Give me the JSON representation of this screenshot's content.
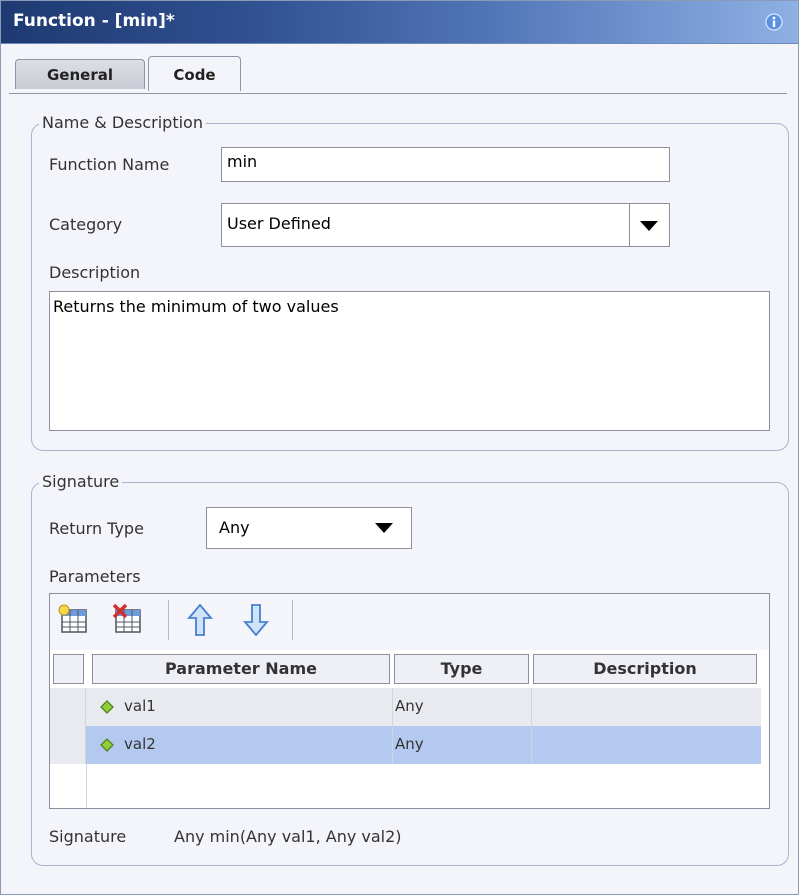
{
  "window": {
    "title": "Function - [min]*"
  },
  "tabs": [
    {
      "label": "General",
      "active": false
    },
    {
      "label": "Code",
      "active": true
    }
  ],
  "name_description": {
    "legend": "Name & Description",
    "function_name_label": "Function Name",
    "function_name_value": "min",
    "category_label": "Category",
    "category_value": "User Defined",
    "description_label": "Description",
    "description_value": "Returns the minimum of two values"
  },
  "signature": {
    "legend": "Signature",
    "return_type_label": "Return Type",
    "return_type_value": "Any",
    "parameters_label": "Parameters",
    "toolbar": [
      "add-parameter-icon",
      "delete-parameter-icon",
      "move-up-icon",
      "move-down-icon"
    ],
    "columns": [
      "Parameter Name",
      "Type",
      "Description"
    ],
    "rows": [
      {
        "name": "val1",
        "type": "Any",
        "description": "",
        "selected": false
      },
      {
        "name": "val2",
        "type": "Any",
        "description": "",
        "selected": true
      }
    ],
    "signature_label": "Signature",
    "signature_value": "Any min(Any val1, Any val2)"
  },
  "colors": {
    "title_gradient_start": "#1f3a72",
    "title_gradient_end": "#8fb0e4",
    "row_selected": "#b3c9ef",
    "row_alt": "#e8eaf0",
    "param_icon": "#7dbb2e"
  }
}
